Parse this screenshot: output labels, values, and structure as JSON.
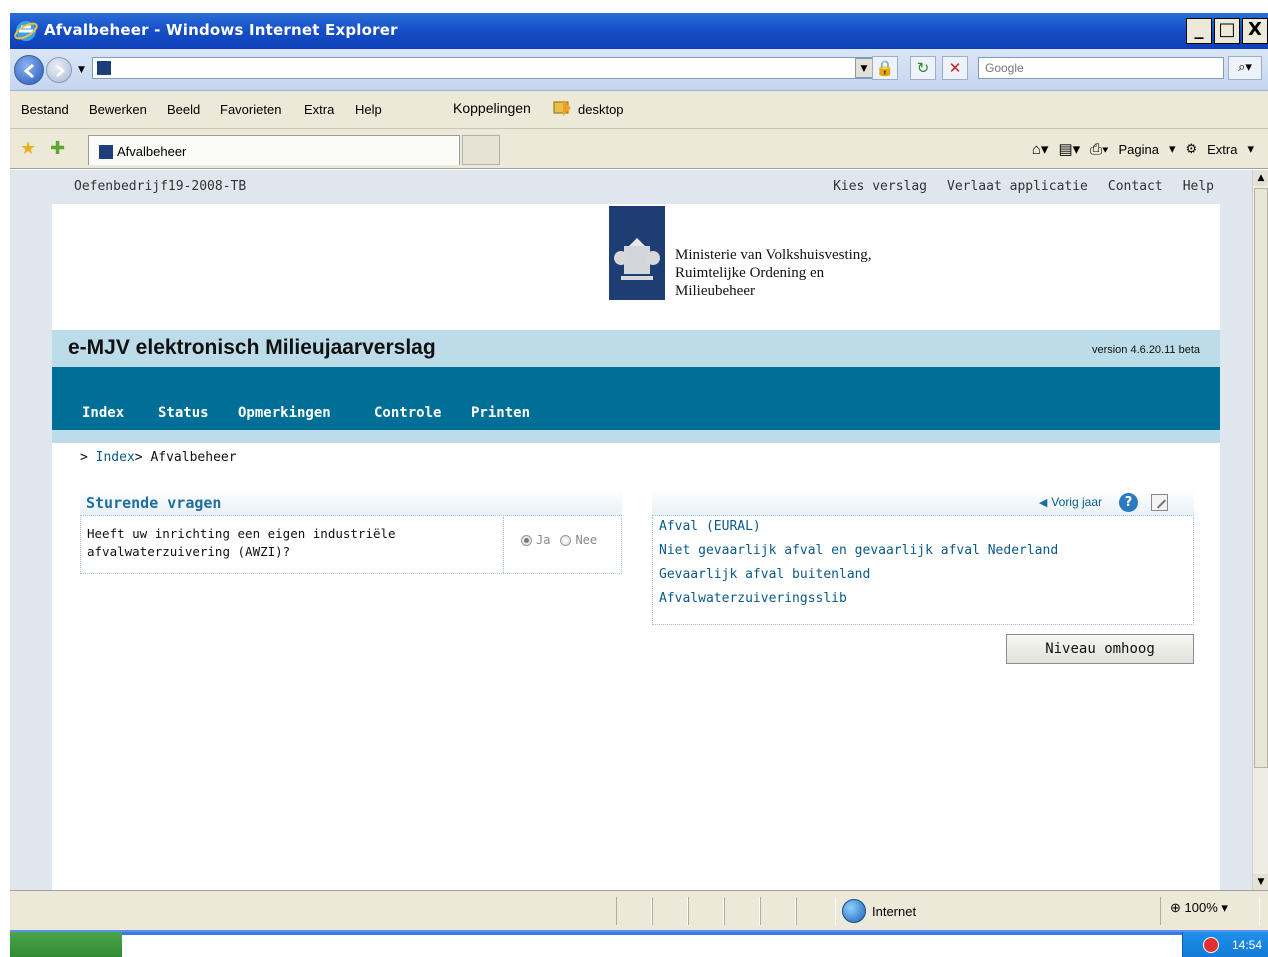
{
  "window": {
    "title": "Afvalbeheer - Windows Internet Explorer",
    "min": "_",
    "max": "□",
    "close": "X"
  },
  "address": {
    "url": "",
    "search_placeholder": "Google"
  },
  "menubar": {
    "items": [
      "Bestand",
      "Bewerken",
      "Beeld",
      "Favorieten",
      "Extra",
      "Help"
    ],
    "links_label": "Koppelingen",
    "desktop_label": "desktop"
  },
  "tabs": {
    "active_tab": "Afvalbeheer"
  },
  "commandbar": {
    "page_label": "Pagina",
    "extra_label": "Extra"
  },
  "top": {
    "company": "Oefenbedrijf19-2008-TB",
    "links": [
      "Kies verslag",
      "Verlaat applicatie",
      "Contact",
      "Help"
    ]
  },
  "logo": {
    "line1": "Ministerie van Volkshuisvesting,",
    "line2": "Ruimtelijke Ordening en",
    "line3": "Milieubeheer"
  },
  "app": {
    "title": "e-MJV elektronisch Milieujaarverslag",
    "version": "version 4.6.20.11 beta"
  },
  "nav": {
    "items": [
      "Index",
      "Status",
      "Opmerkingen",
      "Controle",
      "Printen"
    ]
  },
  "breadcrumb": {
    "prefix": "> ",
    "index": "Index",
    "sep": "> ",
    "current": "Afvalbeheer"
  },
  "sturende": {
    "title": "Sturende vragen",
    "question_line1": "Heeft uw inrichting een eigen industriële",
    "question_line2": "afvalwaterzuivering (AWZI)?",
    "yes": "Ja",
    "no": "Nee",
    "selected": "Ja"
  },
  "right_panel": {
    "prev_year": "Vorig jaar",
    "links": [
      "Afval (EURAL)",
      "Niet gevaarlijk afval en gevaarlijk afval Nederland",
      "Gevaarlijk afval buitenland",
      "Afvalwaterzuiveringsslib"
    ],
    "up_button": "Niveau omhoog"
  },
  "status": {
    "zone": "Internet",
    "zoom": "100%"
  },
  "taskbar": {
    "clock": "14:54"
  },
  "colors": {
    "nav_bg": "#006f97",
    "header_bg": "#bcdce9",
    "link": "#0a5a8a",
    "panel_title": "#1e6fa0",
    "logo_bg": "#1d3d73"
  }
}
